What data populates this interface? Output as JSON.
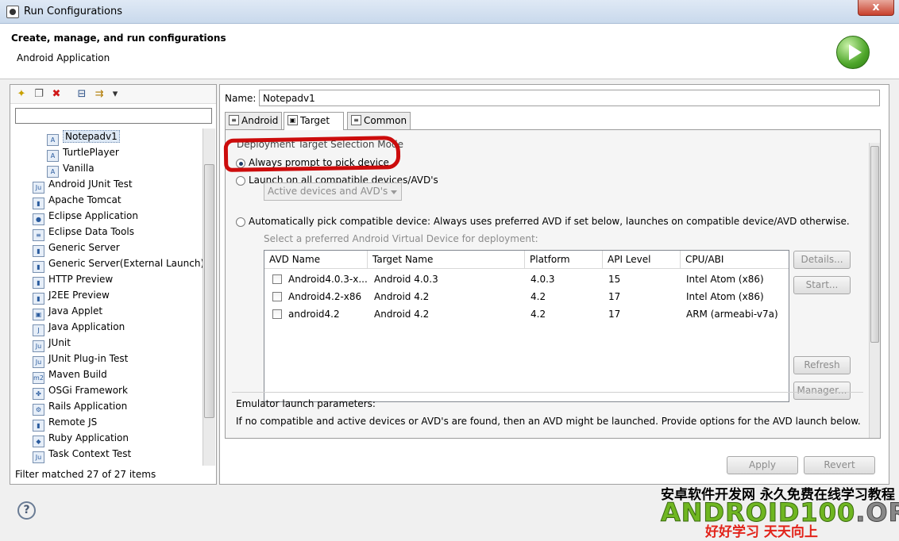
{
  "window": {
    "title": "Run Configurations",
    "close_glyph": "x"
  },
  "header": {
    "title": "Create, manage, and run configurations",
    "subtitle": "Android Application"
  },
  "left": {
    "filter_value": "",
    "toolbar": [
      {
        "name": "new-config-icon",
        "glyph": "✦"
      },
      {
        "name": "duplicate-icon",
        "glyph": "❐"
      },
      {
        "name": "delete-icon",
        "glyph": "✖"
      },
      {
        "name": "collapse-all-icon",
        "glyph": "⊟"
      },
      {
        "name": "filter-icon",
        "glyph": "⇉"
      },
      {
        "name": "menu-dropdown-icon",
        "glyph": "▾"
      }
    ],
    "tree": [
      {
        "label": "Notepadv1",
        "indent": 2,
        "selected": true,
        "icon": "android-config-icon",
        "glyph": "A"
      },
      {
        "label": "TurtlePlayer",
        "indent": 2,
        "icon": "android-config-icon",
        "glyph": "A"
      },
      {
        "label": "Vanilla",
        "indent": 2,
        "icon": "android-config-icon",
        "glyph": "A"
      },
      {
        "label": "Android JUnit Test",
        "indent": 1,
        "icon": "android-junit-icon",
        "glyph": "Ju"
      },
      {
        "label": "Apache Tomcat",
        "indent": 1,
        "icon": "tomcat-icon",
        "glyph": "▮"
      },
      {
        "label": "Eclipse Application",
        "indent": 1,
        "icon": "eclipse-icon",
        "glyph": "●"
      },
      {
        "label": "Eclipse Data Tools",
        "indent": 1,
        "icon": "data-tools-icon",
        "glyph": "≡"
      },
      {
        "label": "Generic Server",
        "indent": 1,
        "icon": "server-icon",
        "glyph": "▮"
      },
      {
        "label": "Generic Server(External Launch)",
        "indent": 1,
        "icon": "server-icon",
        "glyph": "▮"
      },
      {
        "label": "HTTP Preview",
        "indent": 1,
        "icon": "server-icon",
        "glyph": "▮"
      },
      {
        "label": "J2EE Preview",
        "indent": 1,
        "icon": "server-icon",
        "glyph": "▮"
      },
      {
        "label": "Java Applet",
        "indent": 1,
        "icon": "applet-icon",
        "glyph": "▣"
      },
      {
        "label": "Java Application",
        "indent": 1,
        "icon": "java-app-icon",
        "glyph": "J"
      },
      {
        "label": "JUnit",
        "indent": 1,
        "icon": "junit-icon",
        "glyph": "Ju"
      },
      {
        "label": "JUnit Plug-in Test",
        "indent": 1,
        "icon": "junit-plugin-icon",
        "glyph": "Ju"
      },
      {
        "label": "Maven Build",
        "indent": 1,
        "icon": "maven-icon",
        "glyph": "m2"
      },
      {
        "label": "OSGi Framework",
        "indent": 1,
        "icon": "osgi-icon",
        "glyph": "✤"
      },
      {
        "label": "Rails Application",
        "indent": 1,
        "icon": "rails-icon",
        "glyph": "⚙"
      },
      {
        "label": "Remote JS",
        "indent": 1,
        "icon": "remote-js-icon",
        "glyph": "▮"
      },
      {
        "label": "Ruby Application",
        "indent": 1,
        "icon": "ruby-icon",
        "glyph": "◆"
      },
      {
        "label": "Task Context Test",
        "indent": 1,
        "icon": "task-context-icon",
        "glyph": "Ju"
      }
    ],
    "footer": "Filter matched 27 of 27 items"
  },
  "right": {
    "name_label": "Name:",
    "name_value": "Notepadv1",
    "tabs": [
      {
        "label": "Android",
        "glyph": "≡"
      },
      {
        "label": "Target",
        "glyph": "▣",
        "active": true
      },
      {
        "label": "Common",
        "glyph": "≡"
      }
    ],
    "mode_group_label": "Deployment Target Selection Mode",
    "radio_always": "Always prompt to pick device",
    "radio_launch_all": "Launch on all compatible devices/AVD's",
    "combo_value": "Active devices and AVD's",
    "radio_auto": "Automatically pick compatible device: Always uses preferred AVD if set below, launches on compatible device/AVD otherwise.",
    "avd_hint": "Select a preferred Android Virtual Device for deployment:",
    "table": {
      "headers": [
        "AVD Name",
        "Target Name",
        "Platform",
        "API Level",
        "CPU/ABI"
      ],
      "rows": [
        [
          "Android4.0.3-x...",
          "Android 4.0.3",
          "4.0.3",
          "15",
          "Intel Atom (x86)"
        ],
        [
          "Android4.2-x86",
          "Android 4.2",
          "4.2",
          "17",
          "Intel Atom (x86)"
        ],
        [
          "android4.2",
          "Android 4.2",
          "4.2",
          "17",
          "ARM (armeabi-v7a)"
        ]
      ]
    },
    "side_buttons": {
      "details": "Details...",
      "start": "Start...",
      "refresh": "Refresh",
      "manager": "Manager..."
    },
    "emulator_label": "Emulator launch parameters:",
    "emulator_text": "If no compatible and active devices or AVD's are found, then an AVD might be launched. Provide options for the AVD launch below.",
    "apply": "Apply",
    "revert": "Revert"
  },
  "help_glyph": "?",
  "watermark": {
    "line1": "安卓软件开发网  永久免费在线学习教程",
    "brand_green": "ANDROID100",
    "brand_gray": ".ORG",
    "line3": "好好学习  天天向上"
  }
}
